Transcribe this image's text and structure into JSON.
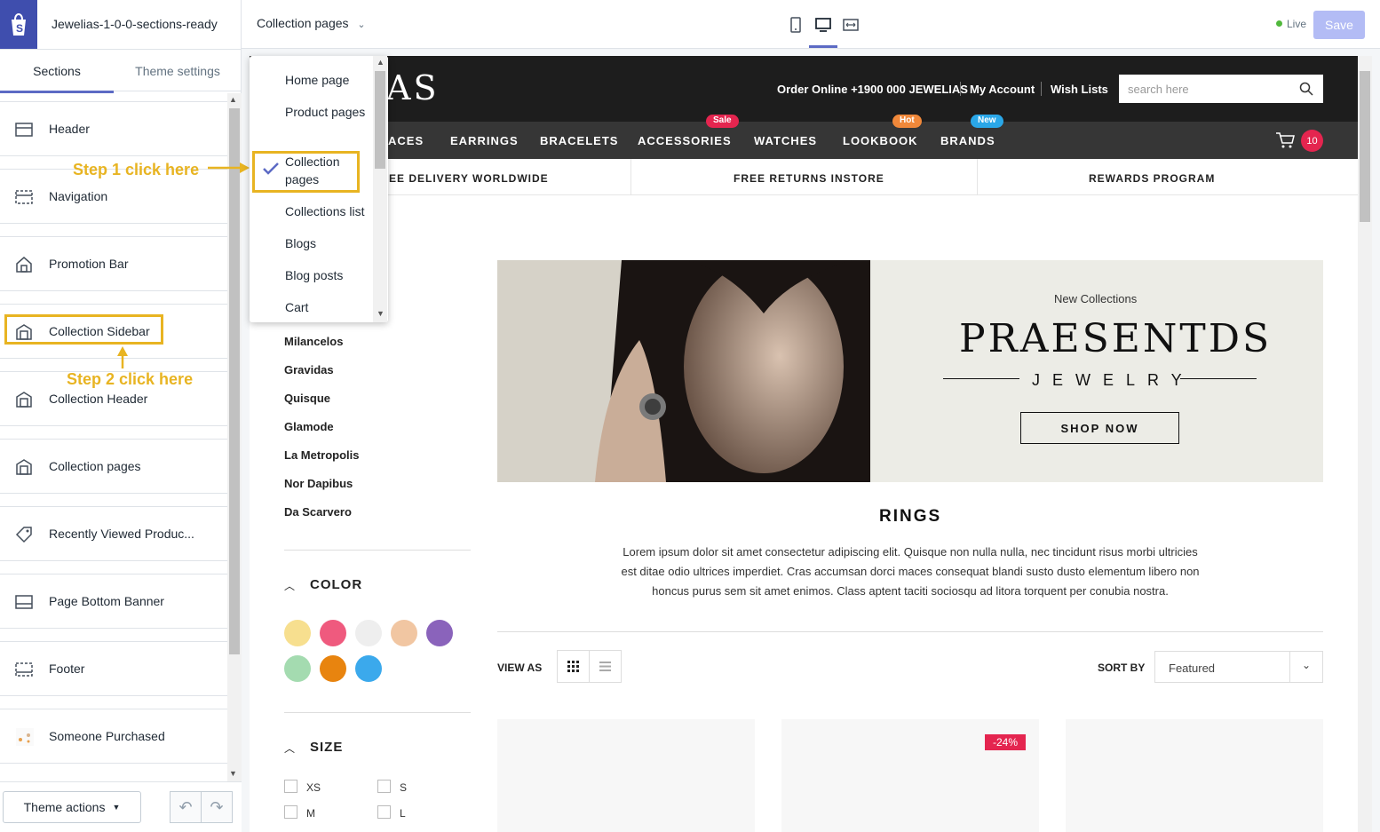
{
  "sidebar": {
    "theme_name": "Jewelias-1-0-0-sections-ready",
    "tabs": [
      "Sections",
      "Theme settings"
    ],
    "sections": [
      {
        "label": "Header",
        "icon": "header-icon"
      },
      {
        "label": "Navigation",
        "icon": "navigation-icon"
      },
      {
        "label": "Promotion Bar",
        "icon": "home-icon"
      },
      {
        "label": "Collection Sidebar",
        "icon": "collection-icon"
      },
      {
        "label": "Collection Header",
        "icon": "collection-icon"
      },
      {
        "label": "Collection pages",
        "icon": "collection-icon"
      },
      {
        "label": "Recently Viewed Produc...",
        "icon": "tag-icon"
      },
      {
        "label": "Page Bottom Banner",
        "icon": "banner-icon"
      },
      {
        "label": "Footer",
        "icon": "footer-icon"
      },
      {
        "label": "Someone Purchased",
        "icon": "product-thumb-icon"
      }
    ],
    "theme_actions": "Theme actions"
  },
  "topbar": {
    "page_select": "Collection pages",
    "live": "Live",
    "save": "Save",
    "devices": [
      "mobile-icon",
      "desktop-icon",
      "fullwidth-icon"
    ]
  },
  "dropdown": {
    "items": [
      "Home page",
      "Product pages",
      "Collection pages",
      "Collections list",
      "Blogs",
      "Blog posts",
      "Cart"
    ],
    "selected": "Collection pages"
  },
  "annotations": {
    "step1": "Step 1 click here",
    "step2": "Step 2 click here"
  },
  "store": {
    "logo": "IAS",
    "order_online": "Order Online +1900 000 JEWELIAS",
    "my_account": "My Account",
    "wish_lists": "Wish Lists",
    "search_placeholder": "search here",
    "nav": [
      "ACES",
      "EARRINGS",
      "BRACELETS",
      "ACCESSORIES",
      "WATCHES",
      "LOOKBOOK",
      "BRANDS"
    ],
    "badges": {
      "sale": "Sale",
      "hot": "Hot",
      "new": "New"
    },
    "cart_count": "10",
    "promo": [
      "EE DELIVERY WORLDWIDE",
      "FREE RETURNS INSTORE",
      "REWARDS PROGRAM"
    ],
    "categories": [
      "Milancelos",
      "Gravidas",
      "Quisque",
      "Glamode",
      "La Metropolis",
      "Nor Dapibus",
      "Da Scarvero"
    ],
    "color_heading": "COLOR",
    "colors": [
      "#f7df8f",
      "#ef5a7e",
      "#eeeeee",
      "#f1c6a2",
      "#8a63bb",
      "#a4dbb0",
      "#e8840f",
      "#3ba9ec"
    ],
    "size_heading": "SIZE",
    "sizes": [
      "XS",
      "S",
      "M",
      "L"
    ],
    "banner": {
      "subtitle": "New Collections",
      "title": "PRAESENTDS",
      "tagline": "JEWELRY",
      "button": "SHOP NOW"
    },
    "collection_title": "RINGS",
    "description": [
      "Lorem ipsum dolor sit amet consectetur adipiscing elit. Quisque non nulla nulla, nec tincidunt risus morbi ultricies",
      "est ditae odio ultrices imperdiet. Cras accumsan dorci maces consequat blandi susto dusto elementum libero non",
      "honcus purus sem sit amet enimos. Class aptent taciti sociosqu ad litora torquent per conubia nostra."
    ],
    "view_as": "VIEW AS",
    "sort_by": "SORT BY",
    "sort_value": "Featured",
    "discount": "-24%"
  }
}
